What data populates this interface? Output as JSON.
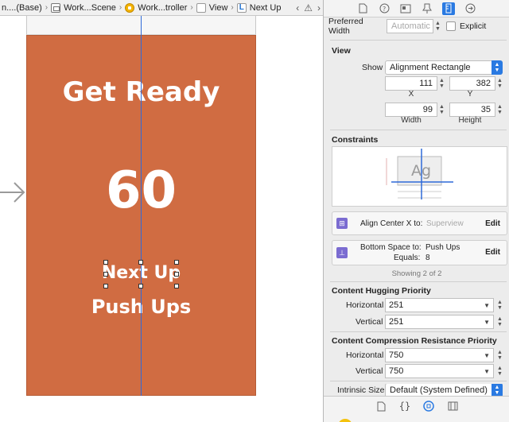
{
  "jumpbar": {
    "items": [
      {
        "label": "n....(Base)",
        "icon": "storyboard-icon"
      },
      {
        "label": "Work...Scene",
        "icon": "scene-icon"
      },
      {
        "label": "Work...troller",
        "icon": "view-controller-icon"
      },
      {
        "label": "View",
        "icon": "view-icon"
      },
      {
        "label": "Next Up",
        "icon": "label-icon"
      }
    ],
    "separator": "›",
    "nav_back": "‹",
    "warning": "⚠",
    "nav_forward": "›"
  },
  "screen": {
    "title": "Get Ready",
    "count": "60",
    "next_label": "Next Up",
    "exercise": "Push Ups",
    "background": "#d06c42"
  },
  "inspector": {
    "tabs": [
      "file-icon",
      "help-icon",
      "identity-icon",
      "attributes-icon",
      "size-icon",
      "connections-icon"
    ],
    "preferred_width": {
      "label": "Preferred Width",
      "placeholder": "Automatic",
      "explicit_label": "Explicit"
    },
    "view_section": {
      "title": "View",
      "show_label": "Show",
      "show_value": "Alignment Rectangle",
      "x": {
        "value": "111",
        "label": "X"
      },
      "y": {
        "value": "382",
        "label": "Y"
      },
      "width": {
        "value": "99",
        "label": "Width"
      },
      "height": {
        "value": "35",
        "label": "Height"
      }
    },
    "constraints": {
      "title": "Constraints",
      "preview_text": "Ag",
      "items": [
        {
          "line1_label": "Align Center X to:",
          "line1_value": "Superview",
          "line2": "",
          "edit": "Edit"
        },
        {
          "line1_label": "Bottom Space to:",
          "line1_value": "Push Ups",
          "line2_label": "Equals:",
          "line2_value": "8",
          "edit": "Edit"
        }
      ],
      "showing": "Showing 2 of 2"
    },
    "hugging": {
      "title": "Content Hugging Priority",
      "horizontal_label": "Horizontal",
      "horizontal_value": "251",
      "vertical_label": "Vertical",
      "vertical_value": "251"
    },
    "compression": {
      "title": "Content Compression Resistance Priority",
      "horizontal_label": "Horizontal",
      "horizontal_value": "750",
      "vertical_label": "Vertical",
      "vertical_value": "750"
    },
    "intrinsic": {
      "label": "Intrinsic Size",
      "value": "Default (System Defined)"
    },
    "bottom_tabs": [
      "file-template-icon",
      "code-snippet-icon",
      "object-library-icon",
      "media-library-icon"
    ]
  },
  "colors": {
    "accent": "#2a7ae2",
    "guide": "#2f6ad9",
    "constraint_icon": "#7b6cd1",
    "warning": "#e0a800"
  }
}
